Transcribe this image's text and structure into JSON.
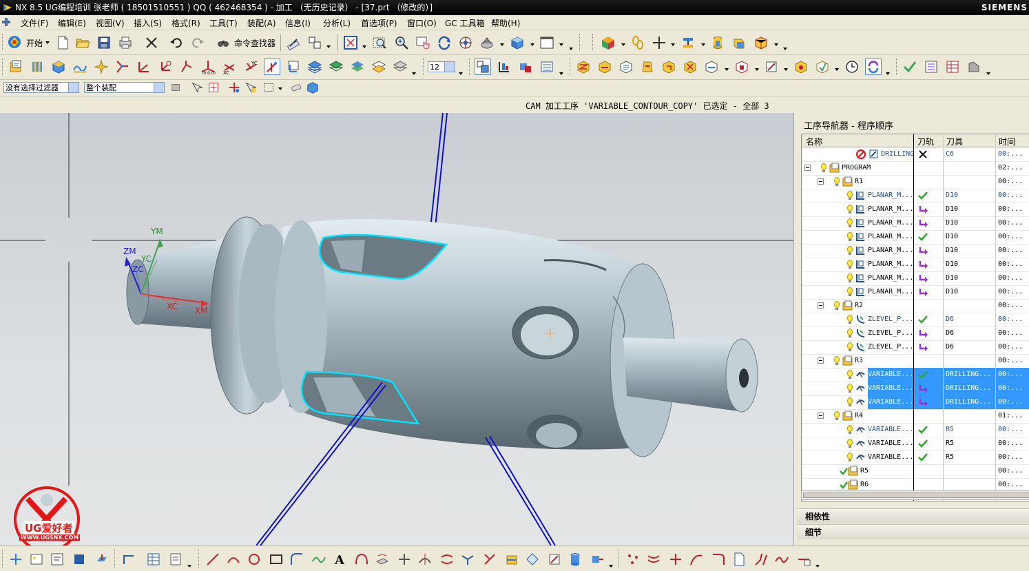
{
  "title": {
    "text": "NX 8.5  UG编程培训 张老师 ( 18501510551 ) QQ ( 462468354 )  - 加工 （无历史记录） - [37.prt （修改的）]",
    "brand": "SIEMENS"
  },
  "menu": [
    "文件(F)",
    "编辑(E)",
    "视图(V)",
    "插入(S)",
    "格式(R)",
    "工具(T)",
    "装配(A)",
    "信息(I)",
    "分析(L)",
    "首选项(P)",
    "窗口(O)",
    "GC 工具箱",
    "帮助(H)"
  ],
  "toolbar": {
    "start_label": "开始",
    "command_finder_label": "命令查找器",
    "font_size_value": "12",
    "filter_value": "没有选择过滤器",
    "scope_value": "整个装配"
  },
  "status": {
    "message": "CAM 加工工序 'VARIABLE_CONTOUR_COPY' 已选定 - 全部 3"
  },
  "viewport": {
    "axis_labels": {
      "ym": "YM",
      "zm": "ZM",
      "yc": "YC",
      "zc": "ZC",
      "xc": "XC",
      "xm": "XM"
    },
    "watermark": {
      "text": "UG爱好者",
      "url": "WWW.UGSNX.COM"
    },
    "colors": {
      "highlight": "#00e5ff",
      "axis_lines": "#1010d0",
      "part": "#9fb3bf"
    }
  },
  "navigator": {
    "title": "工序导航器 - 程序顺序",
    "columns": [
      "名称",
      "刀轨",
      "刀具",
      "时间"
    ],
    "rows": [
      {
        "name": "DRILLING",
        "path": "x",
        "tool": "C6",
        "time": "00:...",
        "level": 3,
        "kind": "drill",
        "status": "error",
        "blue": true
      },
      {
        "name": "PROGRAM",
        "path": "",
        "tool": "",
        "time": "02:...",
        "level": 0,
        "kind": "group",
        "toggle": "-"
      },
      {
        "name": "R1",
        "path": "",
        "tool": "",
        "time": "00:...",
        "level": 1,
        "kind": "group",
        "toggle": "-"
      },
      {
        "name": "PLANAR_M...",
        "path": "ok",
        "tool": "D10",
        "time": "00:...",
        "level": 2,
        "kind": "planar",
        "blue": true
      },
      {
        "name": "PLANAR_M...",
        "path": "re",
        "tool": "D10",
        "time": "00:...",
        "level": 2,
        "kind": "planar"
      },
      {
        "name": "PLANAR_M...",
        "path": "re",
        "tool": "D10",
        "time": "00:...",
        "level": 2,
        "kind": "planar"
      },
      {
        "name": "PLANAR_M...",
        "path": "ok",
        "tool": "D10",
        "time": "00:...",
        "level": 2,
        "kind": "planar"
      },
      {
        "name": "PLANAR_M...",
        "path": "re",
        "tool": "D10",
        "time": "00:...",
        "level": 2,
        "kind": "planar"
      },
      {
        "name": "PLANAR_M...",
        "path": "re",
        "tool": "D10",
        "time": "00:...",
        "level": 2,
        "kind": "planar"
      },
      {
        "name": "PLANAR_M...",
        "path": "re",
        "tool": "D10",
        "time": "00:...",
        "level": 2,
        "kind": "planar"
      },
      {
        "name": "PLANAR_M...",
        "path": "re",
        "tool": "D10",
        "time": "00:...",
        "level": 2,
        "kind": "planar"
      },
      {
        "name": "R2",
        "path": "",
        "tool": "",
        "time": "00:...",
        "level": 1,
        "kind": "group",
        "toggle": "-"
      },
      {
        "name": "ZLEVEL_P...",
        "path": "ok",
        "tool": "D6",
        "time": "00:...",
        "level": 2,
        "kind": "zlevel",
        "blue": true
      },
      {
        "name": "ZLEVEL_P...",
        "path": "re",
        "tool": "D6",
        "time": "00:...",
        "level": 2,
        "kind": "zlevel"
      },
      {
        "name": "ZLEVEL_P...",
        "path": "re",
        "tool": "D6",
        "time": "00:...",
        "level": 2,
        "kind": "zlevel"
      },
      {
        "name": "R3",
        "path": "",
        "tool": "",
        "time": "00:...",
        "level": 1,
        "kind": "group",
        "toggle": "-"
      },
      {
        "name": "VARIABLE...",
        "path": "ok",
        "tool": "DRILLING...",
        "time": "00:...",
        "level": 2,
        "kind": "variable",
        "selected": true
      },
      {
        "name": "VARIABLE...",
        "path": "re",
        "tool": "DRILLING...",
        "time": "00:...",
        "level": 2,
        "kind": "variable",
        "selected": true
      },
      {
        "name": "VARIABLE...",
        "path": "re",
        "tool": "DRILLING...",
        "time": "00:...",
        "level": 2,
        "kind": "variable",
        "selected": true
      },
      {
        "name": "R4",
        "path": "",
        "tool": "",
        "time": "01:...",
        "level": 1,
        "kind": "group",
        "toggle": "-"
      },
      {
        "name": "VARIABLE...",
        "path": "ok",
        "tool": "R5",
        "time": "00:...",
        "level": 2,
        "kind": "variable",
        "blue": true
      },
      {
        "name": "VARIABLE...",
        "path": "ok",
        "tool": "R5",
        "time": "00:...",
        "level": 2,
        "kind": "variable"
      },
      {
        "name": "VARIABLE...",
        "path": "ok",
        "tool": "R5",
        "time": "00:...",
        "level": 2,
        "kind": "variable"
      },
      {
        "name": "R5",
        "path": "",
        "tool": "",
        "time": "00:...",
        "level": 1,
        "kind": "group",
        "status": "done"
      },
      {
        "name": "R6",
        "path": "",
        "tool": "",
        "time": "00:...",
        "level": 1,
        "kind": "group",
        "status": "done"
      }
    ],
    "panels": [
      "相依性",
      "细节"
    ]
  }
}
